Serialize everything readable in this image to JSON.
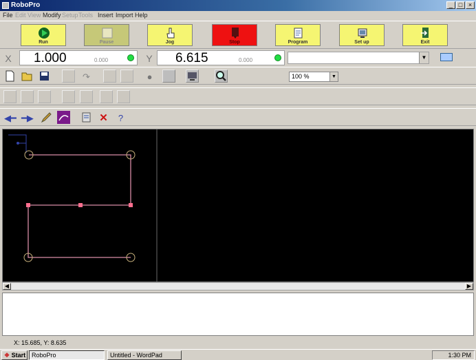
{
  "window": {
    "title": "RoboPro",
    "minimize_glyph": "_",
    "maximize_glyph": "□",
    "close_glyph": "×"
  },
  "menu": {
    "items": [
      "File",
      "Edit",
      "View",
      "Modify",
      "Setup",
      "Tools",
      "Insert",
      "Import",
      "Help"
    ]
  },
  "big_buttons": [
    {
      "label": "Run",
      "color": "#f5f572",
      "icon": "play-icon"
    },
    {
      "label": "Pause",
      "color": "#c6c878",
      "icon": "pause-icon"
    },
    {
      "label": "Jog",
      "color": "#f5f572",
      "icon": "hand-icon"
    },
    {
      "label": "Stop",
      "color": "#ee1111",
      "icon": "stop-icon"
    },
    {
      "label": "Program",
      "color": "#f5f572",
      "icon": "program-icon"
    },
    {
      "label": "Set up",
      "color": "#f5f572",
      "icon": "setup-icon"
    },
    {
      "label": "Exit",
      "color": "#f5f572",
      "icon": "exit-icon"
    }
  ],
  "coords": {
    "x_tag": "X",
    "x_value": "1.000",
    "x_sub": "0.000",
    "y_tag": "Y",
    "y_value": "6.615",
    "y_sub": "0.000",
    "combo_value": ""
  },
  "zoom": {
    "value": "100 %"
  },
  "status": {
    "text": "X: 15.685, Y: 8.635"
  },
  "taskbar": {
    "start_label": "Start",
    "items": [
      "RoboPro",
      "Untitled - WordPad"
    ],
    "clock": "1:30 PM"
  },
  "colors": {
    "canvas_bg": "#000000",
    "path_color": "#d98ca6",
    "node_color": "#ff6f8f",
    "circle_color": "#c9b27d",
    "led_green": "#22dd44",
    "toolbar_purple": "#7a1a8a"
  }
}
